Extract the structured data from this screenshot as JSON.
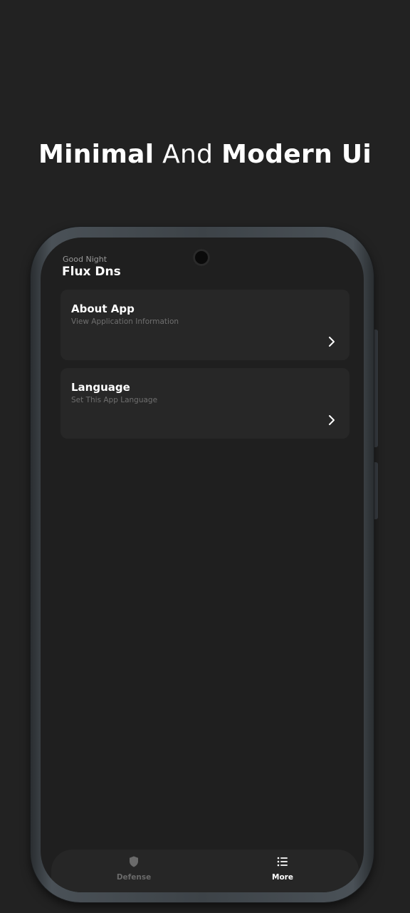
{
  "headline": {
    "bold1": "Minimal",
    "light": "And",
    "bold2": "Modern Ui"
  },
  "header": {
    "greeting": "Good Night",
    "app_name": "Flux Dns"
  },
  "cards": [
    {
      "title": "About App",
      "subtitle": "View Application Information",
      "icon": "chevron-right-icon"
    },
    {
      "title": "Language",
      "subtitle": "Set This App Language",
      "icon": "chevron-right-icon"
    }
  ],
  "bottom_nav": {
    "items": [
      {
        "label": "Defense",
        "icon": "shield-icon",
        "active": false
      },
      {
        "label": "More",
        "icon": "list-icon",
        "active": true
      }
    ]
  },
  "colors": {
    "background": "#222222",
    "screen": "#1f1f1f",
    "card": "#272727",
    "text_primary": "#ffffff",
    "text_secondary": "#6f6f6f",
    "nav_inactive": "#6a6a6a"
  }
}
